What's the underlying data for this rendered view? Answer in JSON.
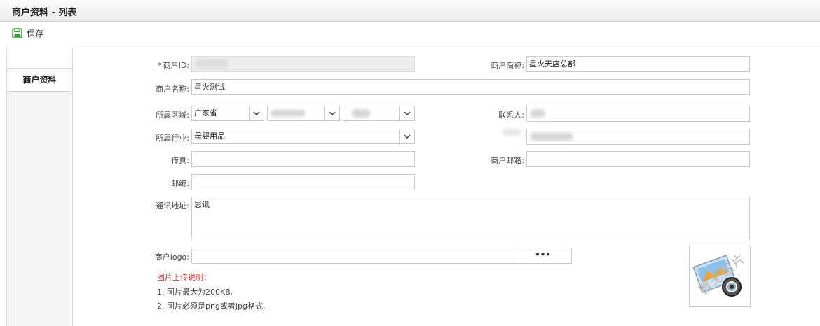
{
  "header": {
    "title": "商户资料 - 列表"
  },
  "toolbar": {
    "save_label": "保存",
    "save_icon": "save-icon"
  },
  "sidebar": {
    "tabs": [
      {
        "label": ""
      },
      {
        "label": "商户资料"
      }
    ]
  },
  "form": {
    "merchant_id": {
      "label": "商户ID:",
      "required_mark": "*",
      "value": ""
    },
    "short_name": {
      "label": "商户简称:",
      "value": "星火天店总部"
    },
    "merchant_name": {
      "label": "商户名称:",
      "value": "星火测试"
    },
    "region": {
      "label": "所属区域:",
      "province": "广东省",
      "city": "",
      "district": ""
    },
    "contact": {
      "label": "联系人:",
      "value": ""
    },
    "industry": {
      "label": "所属行业:",
      "value": "母婴用品"
    },
    "phone": {
      "label": "",
      "value": ""
    },
    "fax": {
      "label": "传真:",
      "value": ""
    },
    "email": {
      "label": "商户邮箱:",
      "value": ""
    },
    "zipcode": {
      "label": "邮编:",
      "value": ""
    },
    "address": {
      "label": "通讯地址:",
      "value": "思讯"
    },
    "logo": {
      "label": "商户logo:",
      "value": "",
      "browse_label": "•••"
    }
  },
  "upload_notes": {
    "title": "图片上传说明：",
    "items": [
      "1. 图片最大为200KB.",
      "2. 图片必须是png或者jpg格式."
    ]
  },
  "logo_preview": {
    "placeholder_text": "暂无图片"
  },
  "colors": {
    "accent_green": "#3b9c3b",
    "required_red": "#dd0000",
    "note_red": "#dd3333"
  }
}
